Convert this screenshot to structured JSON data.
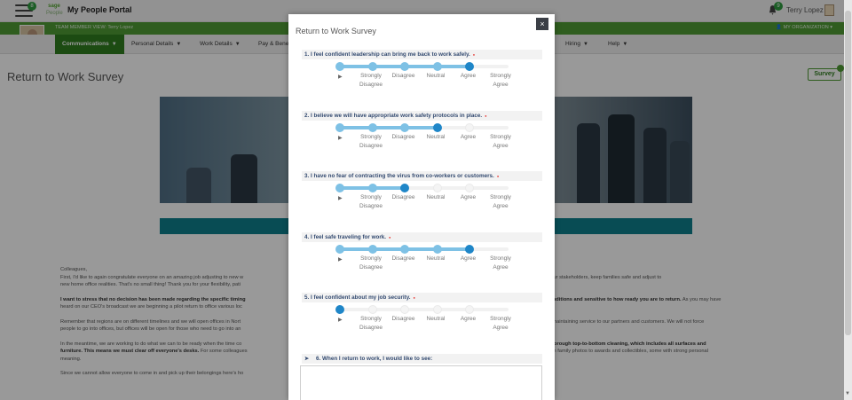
{
  "topbar": {
    "menu_badge": "8",
    "logo_top": "sage",
    "logo_bottom": "People",
    "app_title": "My People Portal",
    "notification_badge": "9",
    "user_name": "Terry Lopez"
  },
  "header": {
    "member_view": "TEAM MEMBER VIEW: Terry Lopez",
    "my_organization": "MY ORGANIZATION"
  },
  "nav": {
    "items": [
      {
        "label": "Communications"
      },
      {
        "label": "Personal Details"
      },
      {
        "label": "Work Details"
      },
      {
        "label": "Pay & Bene"
      },
      {
        "label": "Hiring"
      },
      {
        "label": "Help"
      }
    ]
  },
  "page": {
    "title": "Return to Work Survey",
    "survey_button": "Survey"
  },
  "article": {
    "salutation": "Colleagues,",
    "p1a": "First, I'd like to again congratulate everyone on an amazing job adjusting to new w",
    "p1b": "g, while continuing to take care of our stakeholders, keep families safe and adjust to",
    "p1c": "new home office realities. That's no small thing! Thank you for your flexibility, pati",
    "p2a": "I want to stress that no decision has been made regarding the specific timing",
    "p2b": "h local conditions and sensitive to how ready you are to return.",
    "p2b_tail": " As you may have",
    "p2c": "heard on our CEO's broadcast we are beginning a pilot return to office various loc",
    "p3a": "Remember that regions are on different timelines and we will open offices in Nort",
    "p3b": "safety while maintaining service to our partners and customers. We will not force",
    "p3c": "people to go into offices, but offices will be open for those who need to go into an",
    "p4a": "In the meantime, we are working to do what we can to be ready when the time co",
    "p4b": "conduct a thorough top-to-bottom cleaning, which includes all surfaces and",
    "p4c": "furniture. This means we must clear off everyone's desks.",
    "p4c_tail": " For some colleagues",
    "p4d": "rything from family photos to awards and collectibles, some with strong personal",
    "p4e": "meaning.",
    "p5": "Since we cannot allow everyone to come in and pick up their belongings here's ho"
  },
  "modal": {
    "title": "Return to Work Survey",
    "close_label": "×",
    "scale": [
      "Strongly\nDisagree",
      "Disagree",
      "Neutral",
      "Agree",
      "Strongly\nAgree"
    ],
    "questions": [
      {
        "text": "1. I feel confident leadership can bring me back to work safely.",
        "selected": 4
      },
      {
        "text": "2. I believe we will have appropriate work safety protocols in place.",
        "selected": 3
      },
      {
        "text": "3. I have no fear of contracting the virus from co-workers or customers.",
        "selected": 2
      },
      {
        "text": "4. I feel safe traveling for work.",
        "selected": 4
      },
      {
        "text": "5. I feel confident about my job security.",
        "selected": 0
      }
    ],
    "q6": "6. When I return to work, I would like to see:",
    "q6_answer": ""
  }
}
